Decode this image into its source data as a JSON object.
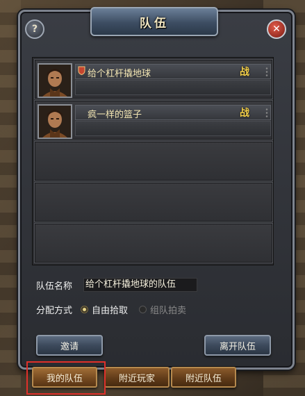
{
  "window": {
    "title": "队伍",
    "help_glyph": "?",
    "close_glyph": "✕"
  },
  "members": [
    {
      "name": "给个杠杆撬地球",
      "is_leader": true,
      "class_label": "战"
    },
    {
      "name": "疯一样的篮子",
      "is_leader": false,
      "class_label": "战"
    }
  ],
  "empty_slots": 3,
  "form": {
    "team_name_label": "队伍名称",
    "team_name_value": "给个杠杆撬地球的队伍",
    "distribution_label": "分配方式",
    "options": [
      {
        "label": "自由拾取",
        "selected": true
      },
      {
        "label": "组队拍卖",
        "selected": false
      }
    ]
  },
  "buttons": {
    "invite": "邀请",
    "leave": "离开队伍"
  },
  "tabs": [
    {
      "label": "我的队伍",
      "active": true
    },
    {
      "label": "附近玩家",
      "active": false
    },
    {
      "label": "附近队伍",
      "active": false
    }
  ],
  "colors": {
    "accent_gold": "#f4d04a",
    "tab_highlight": "#e0302a"
  }
}
